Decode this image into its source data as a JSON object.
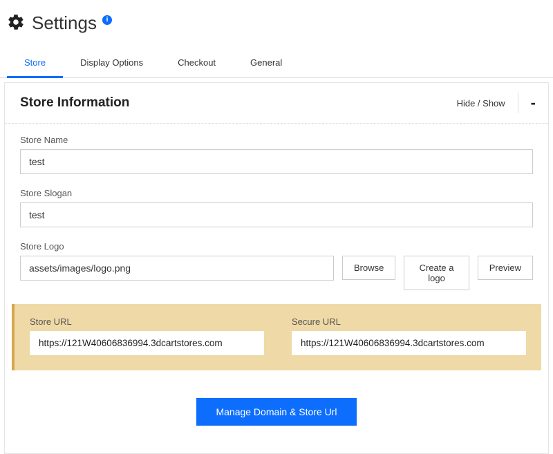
{
  "header": {
    "title": "Settings"
  },
  "tabs": {
    "items": [
      {
        "label": "Store"
      },
      {
        "label": "Display Options"
      },
      {
        "label": "Checkout"
      },
      {
        "label": "General"
      }
    ]
  },
  "panel": {
    "title": "Store Information",
    "hideShow": "Hide / Show",
    "collapse": "-"
  },
  "form": {
    "storeName": {
      "label": "Store Name",
      "value": "test"
    },
    "storeSlogan": {
      "label": "Store Slogan",
      "value": "test"
    },
    "storeLogo": {
      "label": "Store Logo",
      "value": "assets/images/logo.png"
    },
    "buttons": {
      "browse": "Browse",
      "createLogo": "Create a logo",
      "preview": "Preview"
    }
  },
  "urls": {
    "storeUrl": {
      "label": "Store URL",
      "value": "https://121W40606836994.3dcartstores.com"
    },
    "secureUrl": {
      "label": "Secure URL",
      "value": "https://121W40606836994.3dcartstores.com"
    }
  },
  "footer": {
    "manage": "Manage Domain & Store Url"
  }
}
